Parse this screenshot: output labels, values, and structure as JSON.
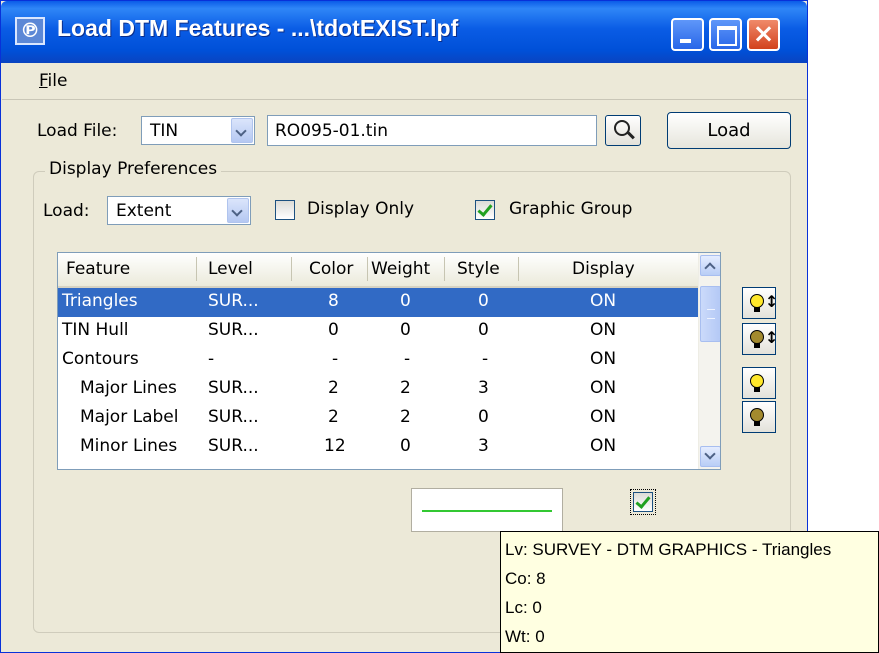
{
  "window": {
    "title": "Load DTM Features - ...\\tdotEXIST.lpf",
    "app_icon_glyph": "℗"
  },
  "menu": {
    "file": "File"
  },
  "load_file": {
    "label": "Load File:",
    "type_value": "TIN",
    "path_value": "RO095-01.tin",
    "load_button": "Load"
  },
  "display_prefs": {
    "title": "Display Preferences",
    "load_label": "Load:",
    "load_value": "Extent",
    "display_only_label": "Display Only",
    "display_only_checked": false,
    "graphic_group_label": "Graphic Group",
    "graphic_group_checked": true
  },
  "table": {
    "headers": [
      "Feature",
      "Level",
      "Color",
      "Weight",
      "Style",
      "Display"
    ],
    "rows": [
      {
        "feature": "Triangles",
        "level": "SUR...",
        "color": "8",
        "weight": "0",
        "style": "0",
        "display": "ON",
        "selected": true
      },
      {
        "feature": "TIN Hull",
        "level": "SUR...",
        "color": "0",
        "weight": "0",
        "style": "0",
        "display": "ON"
      },
      {
        "feature": "Contours",
        "level": "-",
        "color": "-",
        "weight": "-",
        "style": "-",
        "display": "ON"
      },
      {
        "feature": "Major Lines",
        "level": "SUR...",
        "color": "2",
        "weight": "2",
        "style": "3",
        "display": "ON"
      },
      {
        "feature": "Major Label",
        "level": "SUR...",
        "color": "2",
        "weight": "2",
        "style": "0",
        "display": "ON"
      },
      {
        "feature": "Minor Lines",
        "level": "SUR...",
        "color": "12",
        "weight": "0",
        "style": "3",
        "display": "ON"
      }
    ]
  },
  "side_buttons": {
    "b1_glyph": "↕",
    "b2_glyph": "↕"
  },
  "preview_checkbox_checked": true,
  "colors": {
    "selection": "#316ac5",
    "preview_line": "#32c832",
    "tooltip_bg": "#ffffe1"
  },
  "tooltip": {
    "line1": "Lv: SURVEY - DTM GRAPHICS - Triangles",
    "line2": "Co: 8",
    "line3": "Lc: 0",
    "line4": "Wt: 0"
  }
}
